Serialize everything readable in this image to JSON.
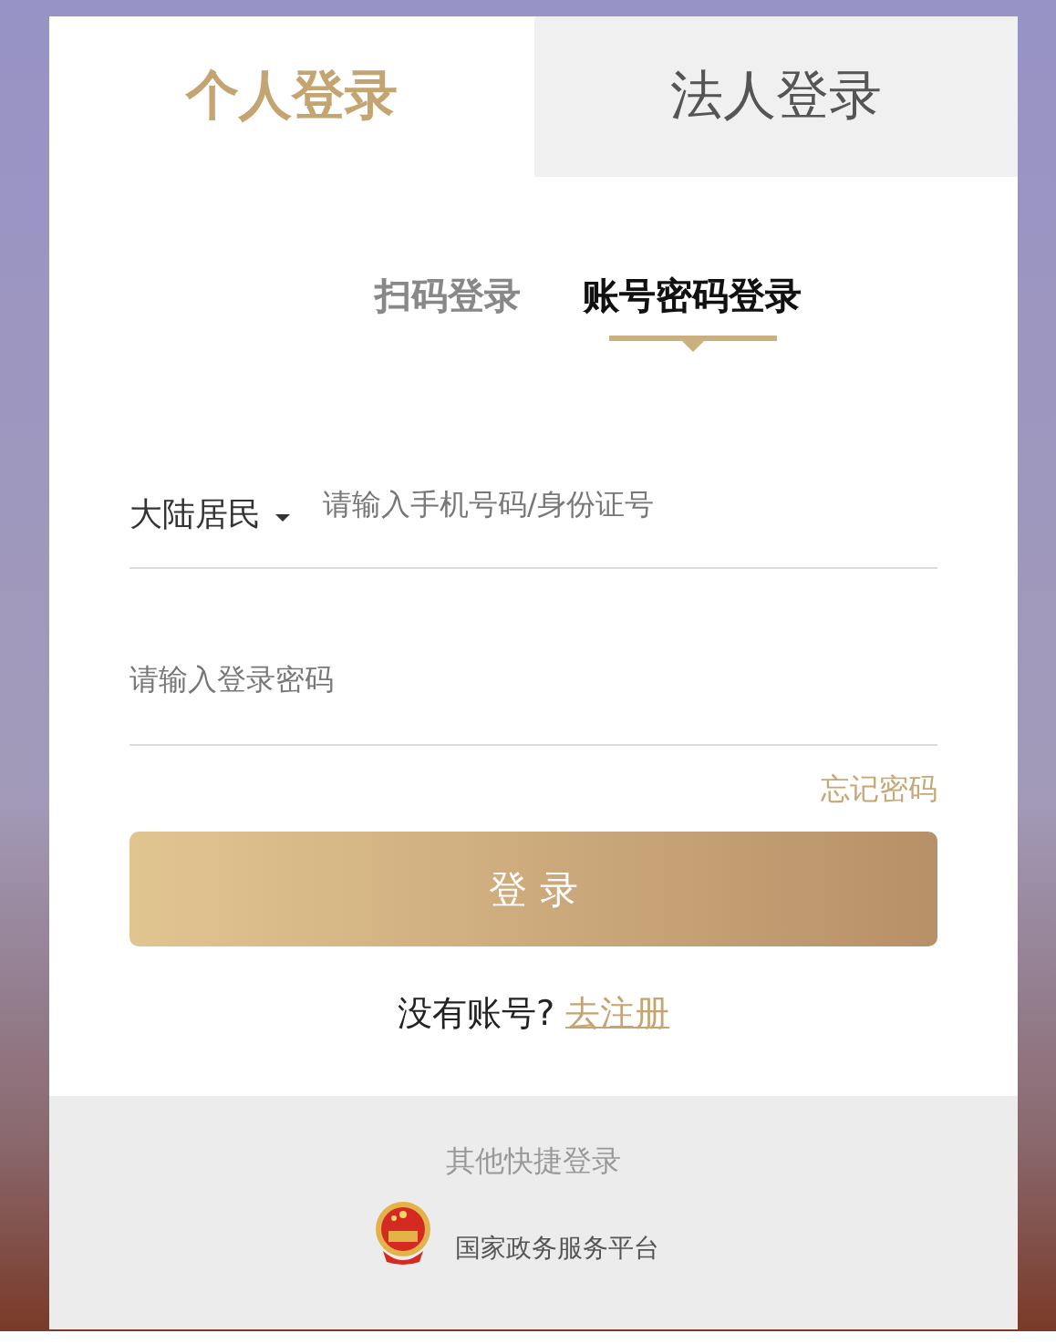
{
  "tabs": [
    {
      "label": "个人登录",
      "selected": true
    },
    {
      "label": "法人登录",
      "selected": false
    }
  ],
  "login_methods": [
    {
      "label": "扫码登录",
      "selected": false
    },
    {
      "label": "账号密码登录",
      "selected": true
    }
  ],
  "account": {
    "region": "大陆居民",
    "placeholder": "请输入手机号码/身份证号"
  },
  "password": {
    "placeholder": "请输入登录密码"
  },
  "forgot_link": "忘记密码",
  "login_button": "登 录",
  "register": {
    "prompt": "没有账号?",
    "link": "去注册"
  },
  "quick_login": {
    "title": "其他快捷登录",
    "providers": [
      {
        "label": "国家政务服务平台"
      }
    ]
  }
}
